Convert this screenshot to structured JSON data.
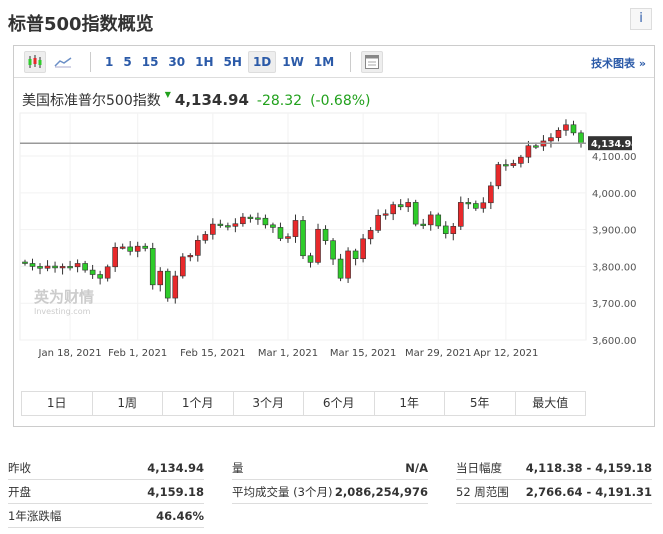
{
  "title": "标普500指数概览",
  "info_label": "i",
  "toolbar": {
    "intervals": [
      "1",
      "5",
      "15",
      "30",
      "1H",
      "5H",
      "1D",
      "1W",
      "1M"
    ],
    "selected": "1D",
    "tech_chart": "技术图表 »"
  },
  "instrument": {
    "name": "美国标准普尔500指数",
    "last": "4,134.94",
    "change": "-28.32",
    "change_pct": "(-0.68%)"
  },
  "ranges": [
    "1日",
    "1周",
    "1个月",
    "3个月",
    "6个月",
    "1年",
    "5年",
    "最大值"
  ],
  "watermark": {
    "cn": "英为财情",
    "en": "Investing.com"
  },
  "colors": {
    "up": "#e8292b",
    "down": "#2ecc2a",
    "price_line": "#999999",
    "label_bg": "#333333"
  },
  "chart_data": {
    "type": "candlestick",
    "ylim": [
      3600,
      4217
    ],
    "yticks": [
      "3,600.00",
      "3,700.00",
      "3,800.00",
      "3,900.00",
      "4,000.00",
      "4,100.00"
    ],
    "ytick_values": [
      3600,
      3700,
      3800,
      3900,
      4000,
      4100
    ],
    "xticks": [
      {
        "label": "Jan 18, 2021",
        "index": 6
      },
      {
        "label": "Feb 1, 2021",
        "index": 15
      },
      {
        "label": "Feb 15, 2021",
        "index": 25
      },
      {
        "label": "Mar 1, 2021",
        "index": 35
      },
      {
        "label": "Mar 15, 2021",
        "index": 45
      },
      {
        "label": "Mar 29, 2021",
        "index": 55
      },
      {
        "label": "Apr 12, 2021",
        "index": 64
      }
    ],
    "last_price": 4134.94,
    "last_label": "4,134.94",
    "closes": [
      3808,
      3800,
      3795,
      3801,
      3796,
      3800,
      3799,
      3808,
      3790,
      3778,
      3768,
      3799,
      3852,
      3853,
      3841,
      3855,
      3849,
      3750,
      3787,
      3714,
      3774,
      3826,
      3830,
      3871,
      3887,
      3915,
      3911,
      3909,
      3916,
      3934,
      3932,
      3931,
      3913,
      3906,
      3876,
      3881,
      3925,
      3829,
      3811,
      3901,
      3870,
      3820,
      3768,
      3842,
      3821,
      3875,
      3898,
      3939,
      3943,
      3968,
      3962,
      3974,
      3915,
      3913,
      3940,
      3910,
      3889,
      3909,
      3974,
      3971,
      3958,
      3973,
      4019,
      4077,
      4074,
      4080,
      4097,
      4128,
      4127,
      4141,
      4150,
      4170,
      4185,
      4163,
      4134.94
    ]
  },
  "stats": [
    [
      {
        "k": "昨收",
        "v": "4,134.94"
      },
      {
        "k": "开盘",
        "v": "4,159.18"
      },
      {
        "k": "1年涨跌幅",
        "v": "46.46%"
      }
    ],
    [
      {
        "k": "量",
        "v": "N/A"
      },
      {
        "k": "平均成交量 (3个月)",
        "v": "2,086,254,976"
      }
    ],
    [
      {
        "k": "当日幅度",
        "v": "4,118.38 - 4,159.18"
      },
      {
        "k": "52 周范围",
        "v": "2,766.64 - 4,191.31"
      }
    ]
  ]
}
